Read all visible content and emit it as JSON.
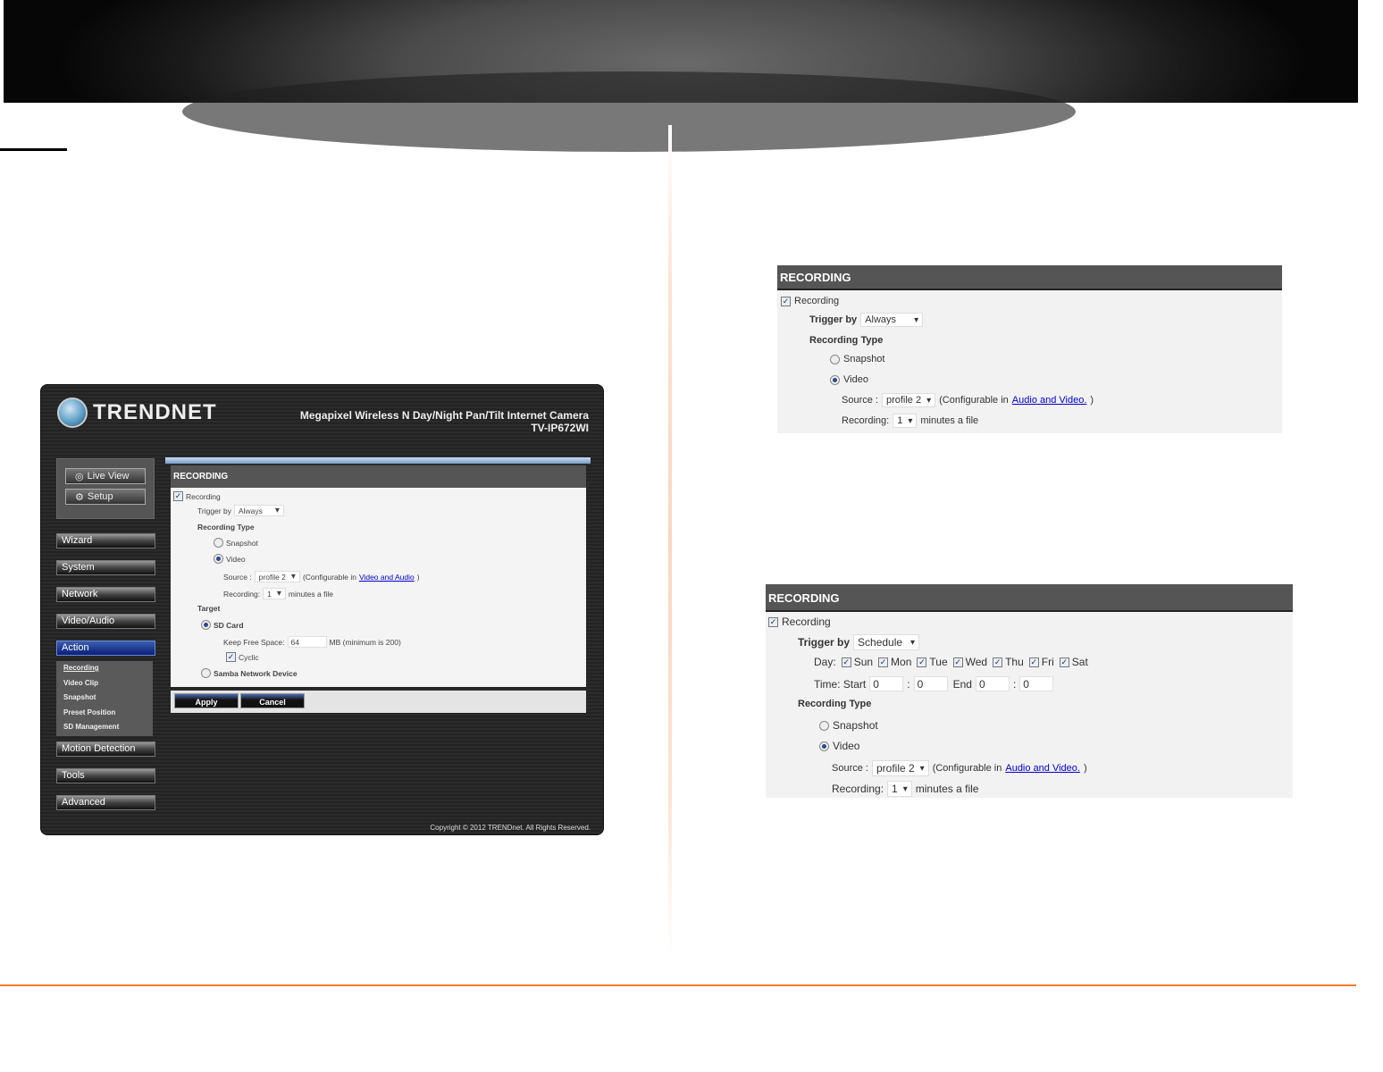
{
  "camera_ui": {
    "brand": "TRENDNET",
    "product_line1": "Megapixel Wireless N Day/Night Pan/Tilt Internet Camera",
    "product_line2": "TV-IP672WI",
    "live_view": "Live View",
    "setup": "Setup",
    "nav": [
      "Wizard",
      "System",
      "Network",
      "Video/Audio",
      "Action"
    ],
    "action_sub": [
      "Recording",
      "Video Clip",
      "Snapshot",
      "Preset Position",
      "SD Management"
    ],
    "nav_bottom": [
      "Motion Detection",
      "Tools",
      "Advanced"
    ],
    "panel": {
      "title": "RECORDING",
      "recording": "Recording",
      "trigger_label": "Trigger by",
      "trigger_value": "Always",
      "type_label": "Recording Type",
      "snapshot": "Snapshot",
      "video": "Video",
      "source_label": "Source :",
      "source_value": "profile 2",
      "config_prefix": "(Configurable in",
      "config_link": "Video and Audio",
      "config_suffix": ")",
      "rec_label": "Recording:",
      "rec_value": "1",
      "rec_suffix": "minutes a file",
      "target_label": "Target",
      "sd_card": "SD Card",
      "keep_free_label": "Keep Free Space:",
      "keep_free_value": "64",
      "keep_free_suffix": "MB (minimum is 200)",
      "cyclic": "Cyclic",
      "samba": "Samba Network Device"
    },
    "apply": "Apply",
    "cancel": "Cancel",
    "copyright": "Copyright © 2012 TRENDnet. All Rights Reserved."
  },
  "panel_always": {
    "title": "RECORDING",
    "recording": "Recording",
    "trigger_label": "Trigger by",
    "trigger_value": "Always",
    "type_label": "Recording Type",
    "snapshot": "Snapshot",
    "video": "Video",
    "source_label": "Source :",
    "source_value": "profile 2",
    "config_prefix": "(Configurable in",
    "config_link": "Audio and Video.",
    "config_suffix": ")",
    "rec_label": "Recording:",
    "rec_value": "1",
    "rec_suffix": "minutes a file"
  },
  "panel_schedule": {
    "title": "RECORDING",
    "recording": "Recording",
    "trigger_label": "Trigger by",
    "trigger_value": "Schedule",
    "day_label": "Day:",
    "days": [
      "Sun",
      "Mon",
      "Tue",
      "Wed",
      "Thu",
      "Fri",
      "Sat"
    ],
    "time_label": "Time: Start",
    "start_h": "0",
    "start_m": "0",
    "end_label": "End",
    "end_h": "0",
    "end_m": "0",
    "colon": ":",
    "type_label": "Recording Type",
    "snapshot": "Snapshot",
    "video": "Video",
    "source_label": "Source :",
    "source_value": "profile 2",
    "config_prefix": "(Configurable in",
    "config_link": "Audio and Video.",
    "config_suffix": ")",
    "rec_label": "Recording:",
    "rec_value": "1",
    "rec_suffix": "minutes a file"
  }
}
